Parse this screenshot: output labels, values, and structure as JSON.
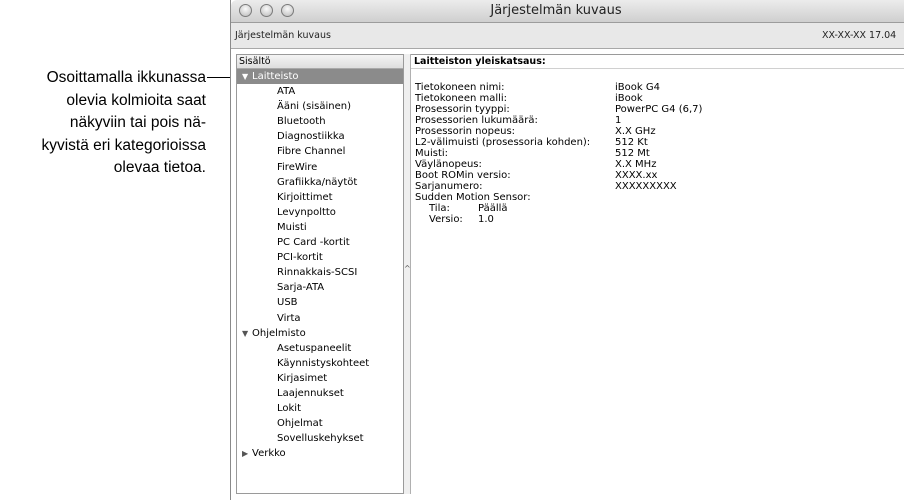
{
  "callout": {
    "lines": [
      "Osoittamalla ikkunassa",
      "olevia kolmioita saat",
      "näkyviin tai pois nä-",
      "kyvistä eri kategorioissa",
      "olevaa tietoa."
    ]
  },
  "window": {
    "title": "Järjestelmän kuvaus",
    "toolbar_left": "Järjestelmän kuvaus",
    "toolbar_right": "XX-XX-XX 17.04"
  },
  "sidebar": {
    "header": "Sisältö",
    "rows": [
      {
        "label": "Laitteisto",
        "kind": "cat",
        "triangle": "▼",
        "selected": true
      },
      {
        "label": "ATA",
        "kind": "child"
      },
      {
        "label": "Ääni (sisäinen)",
        "kind": "child"
      },
      {
        "label": "Bluetooth",
        "kind": "child"
      },
      {
        "label": "Diagnostiikka",
        "kind": "child"
      },
      {
        "label": "Fibre Channel",
        "kind": "child"
      },
      {
        "label": "FireWire",
        "kind": "child"
      },
      {
        "label": "Grafiikka/näytöt",
        "kind": "child"
      },
      {
        "label": "Kirjoittimet",
        "kind": "child"
      },
      {
        "label": "Levynpoltto",
        "kind": "child"
      },
      {
        "label": "Muisti",
        "kind": "child"
      },
      {
        "label": "PC Card -kortit",
        "kind": "child"
      },
      {
        "label": "PCI-kortit",
        "kind": "child"
      },
      {
        "label": "Rinnakkais-SCSI",
        "kind": "child"
      },
      {
        "label": "Sarja-ATA",
        "kind": "child"
      },
      {
        "label": "USB",
        "kind": "child"
      },
      {
        "label": "Virta",
        "kind": "child"
      },
      {
        "label": "Ohjelmisto",
        "kind": "cat",
        "triangle": "▼"
      },
      {
        "label": "Asetuspaneelit",
        "kind": "child"
      },
      {
        "label": "Käynnistyskohteet",
        "kind": "child"
      },
      {
        "label": "Kirjasimet",
        "kind": "child"
      },
      {
        "label": "Laajennukset",
        "kind": "child"
      },
      {
        "label": "Lokit",
        "kind": "child"
      },
      {
        "label": "Ohjelmat",
        "kind": "child"
      },
      {
        "label": "Sovelluskehykset",
        "kind": "child"
      },
      {
        "label": "Verkko",
        "kind": "cat",
        "triangle": "▶"
      }
    ]
  },
  "detail": {
    "title": "Laitteiston yleiskatsaus:",
    "fields": [
      {
        "key": "Tietokoneen nimi:",
        "value": "iBook G4"
      },
      {
        "key": "Tietokoneen malli:",
        "value": "iBook"
      },
      {
        "key": "Prosessorin tyyppi:",
        "value": "PowerPC G4 (6,7)"
      },
      {
        "key": "Prosessorien lukumäärä:",
        "value": "1"
      },
      {
        "key": "Prosessorin nopeus:",
        "value": "X.X GHz"
      },
      {
        "key": "L2-välimuisti (prosessoria kohden):",
        "value": "512 Kt"
      },
      {
        "key": "Muisti:",
        "value": "512 Mt"
      },
      {
        "key": "Väylänopeus:",
        "value": "X.X MHz"
      },
      {
        "key": "Boot ROMin versio:",
        "value": "XXXX.xx"
      },
      {
        "key": "Sarjanumero:",
        "value": "XXXXXXXXX"
      }
    ],
    "sms_label": "Sudden Motion Sensor:",
    "sms_fields": [
      {
        "key": "Tila:",
        "value": "Päällä"
      },
      {
        "key": "Versio:",
        "value": "1.0"
      }
    ]
  }
}
